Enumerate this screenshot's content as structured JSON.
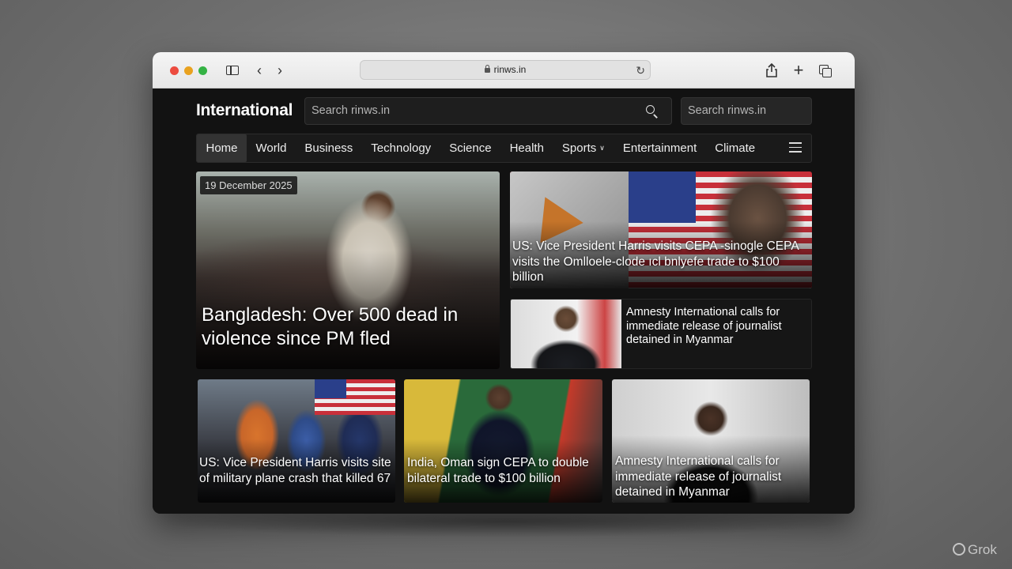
{
  "browser": {
    "url": "rinws.in"
  },
  "site": {
    "title": "International",
    "search_placeholder": "Search rinws.in",
    "search_alt_placeholder": "Search rinws.in"
  },
  "nav": {
    "items": [
      {
        "label": "Home",
        "active": true
      },
      {
        "label": "World"
      },
      {
        "label": "Business"
      },
      {
        "label": "Technology"
      },
      {
        "label": "Science"
      },
      {
        "label": "Health"
      },
      {
        "label": "Sports",
        "has_caret": true
      },
      {
        "label": "Entertainment"
      },
      {
        "label": "Climate"
      }
    ]
  },
  "hero": {
    "date": "19 December 2025",
    "headline": "Bangladesh: Over 500 dead in violence since PM fled"
  },
  "side": [
    {
      "headline": "US: Vice President Harris visits CEPA -sinogle CEPA visits the Omlloele-clode ıcl bnlyefe trade to $100 billion"
    },
    {
      "headline": "Amnesty International calls for immediate release of journalist detained in Myanmar"
    }
  ],
  "bottom": [
    {
      "headline": "US: Vice President Harris visits site of military plane crash that killed 67"
    },
    {
      "headline": "India, Oman sign CEPA to double bilateral trade to $100 billion"
    },
    {
      "headline": "Amnesty International calls for immediate release of journalist detained in Myanmar"
    }
  ],
  "watermark": "Grok"
}
